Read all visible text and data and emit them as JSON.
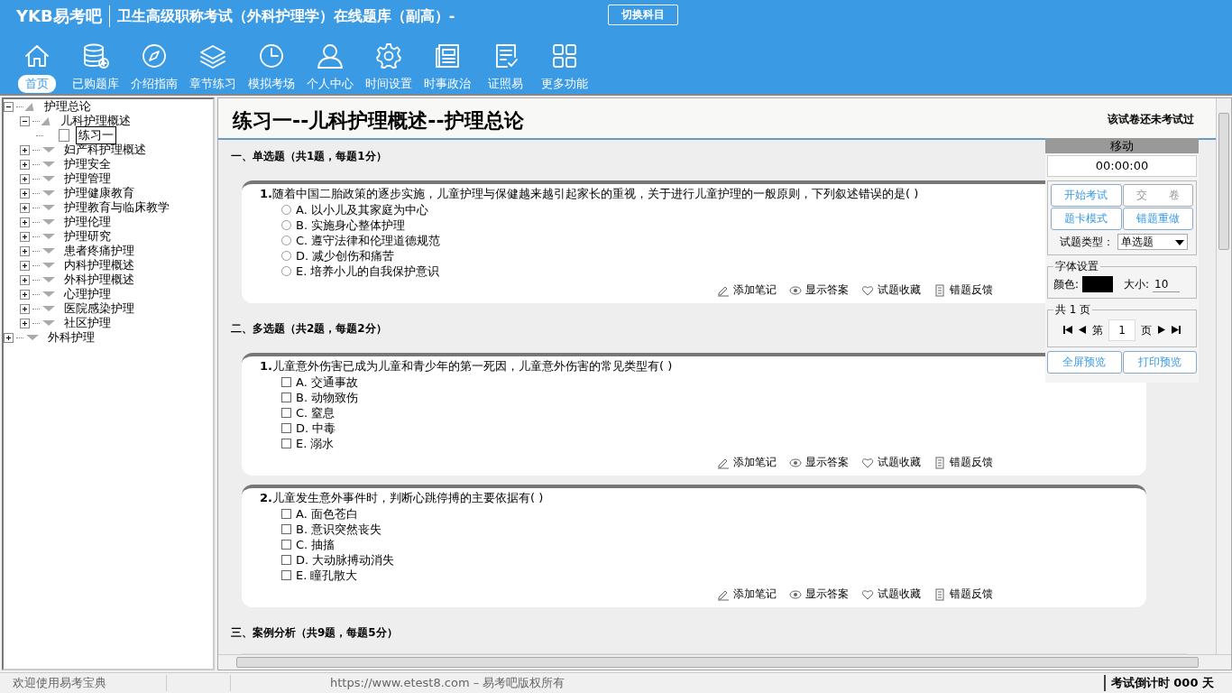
{
  "header": {
    "logo": "YKB易考吧",
    "title": "卫生高级职称考试（外科护理学）在线题库（副高）-",
    "switch_button": "切换科目"
  },
  "toolbar": [
    {
      "label": "首页",
      "selected": true
    },
    {
      "label": "已购题库",
      "selected": false
    },
    {
      "label": "介绍指南",
      "selected": false
    },
    {
      "label": "章节练习",
      "selected": false
    },
    {
      "label": "模拟考场",
      "selected": false
    },
    {
      "label": "个人中心",
      "selected": false
    },
    {
      "label": "时间设置",
      "selected": false
    },
    {
      "label": "时事政治",
      "selected": false
    },
    {
      "label": "证照易",
      "selected": false
    },
    {
      "label": "更多功能",
      "selected": false
    }
  ],
  "tree": [
    {
      "label": "护理总论",
      "expanded": true,
      "selected": false,
      "children": [
        {
          "label": "儿科护理概述",
          "expanded": true,
          "selected": false,
          "children": [
            {
              "label": "练习一",
              "kind": "leaf",
              "selected": true
            }
          ]
        },
        {
          "label": "妇产科护理概述",
          "expanded": false,
          "selected": false
        },
        {
          "label": "护理安全",
          "expanded": false,
          "selected": false
        },
        {
          "label": "护理管理",
          "expanded": false,
          "selected": false
        },
        {
          "label": "护理健康教育",
          "expanded": false,
          "selected": false
        },
        {
          "label": "护理教育与临床教学",
          "expanded": false,
          "selected": false
        },
        {
          "label": "护理伦理",
          "expanded": false,
          "selected": false
        },
        {
          "label": "护理研究",
          "expanded": false,
          "selected": false
        },
        {
          "label": "患者疼痛护理",
          "expanded": false,
          "selected": false
        },
        {
          "label": "内科护理概述",
          "expanded": false,
          "selected": false
        },
        {
          "label": "外科护理概述",
          "expanded": false,
          "selected": false
        },
        {
          "label": "心理护理",
          "expanded": false,
          "selected": false
        },
        {
          "label": "医院感染护理",
          "expanded": false,
          "selected": false
        },
        {
          "label": "社区护理",
          "expanded": false,
          "selected": false
        }
      ]
    },
    {
      "label": "外科护理",
      "expanded": false,
      "selected": false
    }
  ],
  "exam": {
    "title": "练习一--儿科护理概述--护理总论",
    "status": "该试卷还未考试过",
    "sections": [
      {
        "heading": "一、单选题（共1题，每题1分）",
        "kind": "single",
        "questions": [
          {
            "number": "1.",
            "text": "随着中国二胎政策的逐步实施，儿童护理与保健越来越引起家长的重视，关于进行儿童护理的一般原则，下列叙述错误的是( )",
            "options": [
              {
                "label": "A. 以小儿及其家庭为中心",
                "selected": false
              },
              {
                "label": "B. 实施身心整体护理",
                "selected": false
              },
              {
                "label": "C. 遵守法律和伦理道德规范",
                "selected": false
              },
              {
                "label": "D. 减少创伤和痛苦",
                "selected": false
              },
              {
                "label": "E. 培养小儿的自我保护意识",
                "selected": false
              }
            ],
            "actions": [
              "添加笔记",
              "显示答案",
              "试题收藏",
              "错题反馈"
            ]
          }
        ]
      },
      {
        "heading": "二、多选题（共2题，每题2分）",
        "kind": "multiple",
        "questions": [
          {
            "number": "1.",
            "text": "儿童意外伤害已成为儿童和青少年的第一死因，儿童意外伤害的常见类型有( )",
            "options": [
              {
                "label": "A. 交通事故",
                "selected": false
              },
              {
                "label": "B. 动物致伤",
                "selected": false
              },
              {
                "label": "C. 窒息",
                "selected": false
              },
              {
                "label": "D. 中毒",
                "selected": false
              },
              {
                "label": "E. 溺水",
                "selected": false
              }
            ],
            "actions": [
              "添加笔记",
              "显示答案",
              "试题收藏",
              "错题反馈"
            ]
          },
          {
            "number": "2.",
            "text": "儿童发生意外事件时，判断心跳停搏的主要依据有( )",
            "options": [
              {
                "label": "A. 面色苍白",
                "selected": false
              },
              {
                "label": "B. 意识突然丧失",
                "selected": false
              },
              {
                "label": "C. 抽搐",
                "selected": false
              },
              {
                "label": "D. 大动脉搏动消失",
                "selected": false
              },
              {
                "label": "E. 瞳孔散大",
                "selected": false
              }
            ],
            "actions": [
              "添加笔记",
              "显示答案",
              "试题收藏",
              "错题反馈"
            ]
          }
        ]
      },
      {
        "heading": "三、案例分析（共9题，每题5分）",
        "kind": "case"
      }
    ]
  },
  "panel": {
    "title": "移动",
    "timer": "00:00:00",
    "buttons_top": [
      {
        "label": "开始考试",
        "disabled": false
      },
      {
        "label": "交　　卷",
        "disabled": true
      },
      {
        "label": "题卡模式",
        "disabled": false
      },
      {
        "label": "错题重做",
        "disabled": false
      }
    ],
    "type_label": "试题类型：",
    "type_value": "单选题",
    "font_group": "字体设置",
    "color_label": "颜色:",
    "color": "#000000",
    "size_label": "大小:",
    "size_value": "10",
    "pages_group": "共 1 页",
    "page_prefix": "第",
    "page_value": "1",
    "page_suffix": "页",
    "buttons_bottom": [
      {
        "label": "全屏预览",
        "disabled": false
      },
      {
        "label": "打印预览",
        "disabled": false
      }
    ]
  },
  "status_bar": {
    "welcome": "欢迎使用易考宝典",
    "copyright": "https://www.etest8.com – 易考吧版权所有",
    "countdown": "考试倒计时 000 天"
  }
}
